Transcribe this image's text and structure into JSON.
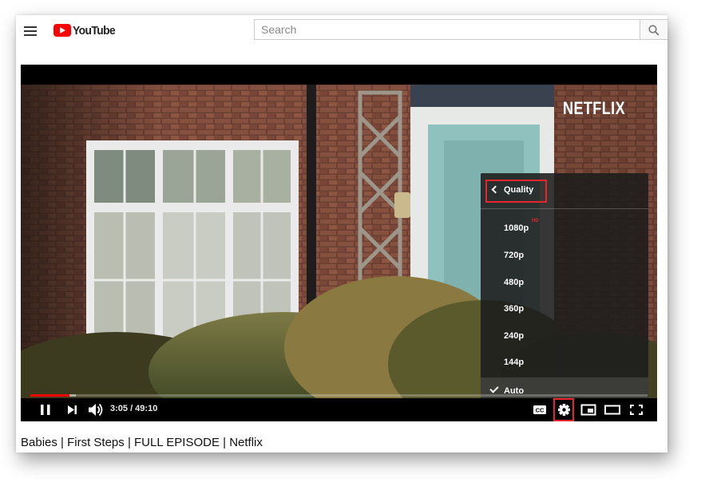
{
  "header": {
    "logo_text": "YouTube",
    "search_placeholder": "Search"
  },
  "video": {
    "watermark": "NETFLIX",
    "title": "Babies | First Steps | FULL EPISODE | Netflix",
    "current_time": "3:05",
    "duration": "49:10",
    "time_display": "3:05 / 49:10",
    "progress_played_fraction": 0.063,
    "progress_loaded_fraction": 0.074
  },
  "quality_menu": {
    "title": "Quality",
    "options": [
      {
        "label": "1080p",
        "badge": "HD",
        "selected": false
      },
      {
        "label": "720p",
        "badge": "",
        "selected": false
      },
      {
        "label": "480p",
        "badge": "",
        "selected": false
      },
      {
        "label": "360p",
        "badge": "",
        "selected": false
      },
      {
        "label": "240p",
        "badge": "",
        "selected": false
      },
      {
        "label": "144p",
        "badge": "",
        "selected": false
      },
      {
        "label": "Auto",
        "badge": "",
        "selected": true
      }
    ]
  },
  "icons": {
    "menu": "hamburger-menu-icon",
    "search": "search-icon",
    "pause": "pause-icon",
    "next": "next-icon",
    "volume": "volume-icon",
    "captions": "cc-icon",
    "settings": "gear-icon",
    "miniplayer": "miniplayer-icon",
    "theater": "theater-mode-icon",
    "fullscreen": "fullscreen-icon"
  },
  "colors": {
    "brand_red": "#ff0000",
    "highlight_red": "#e5262c",
    "player_bg": "#000000"
  }
}
